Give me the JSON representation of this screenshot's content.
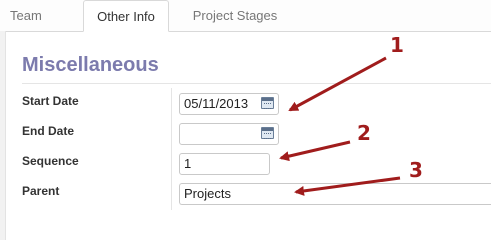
{
  "tabs": [
    {
      "label": "Team"
    },
    {
      "label": "Other Info"
    },
    {
      "label": "Project Stages"
    }
  ],
  "section": {
    "title": "Miscellaneous"
  },
  "fields": {
    "start_date": {
      "label": "Start Date",
      "value": "05/11/2013"
    },
    "end_date": {
      "label": "End Date",
      "value": ""
    },
    "sequence": {
      "label": "Sequence",
      "value": "1"
    },
    "parent": {
      "label": "Parent",
      "value": "Projects"
    }
  },
  "annotations": [
    "1",
    "2",
    "3"
  ],
  "colors": {
    "section_title": "#7c7bad",
    "annotation": "#a01c1c"
  }
}
